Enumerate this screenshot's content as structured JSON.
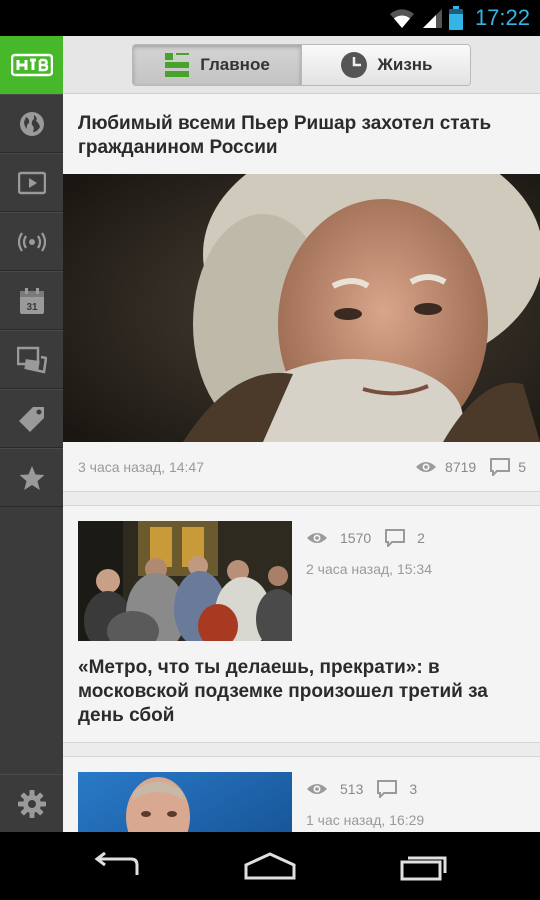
{
  "status_bar": {
    "time": "17:22",
    "icons": [
      "wifi-icon",
      "signal-icon",
      "battery-icon"
    ]
  },
  "sidebar": {
    "logo": "НТВ",
    "items": [
      "globe-icon",
      "video-icon",
      "broadcast-icon",
      "calendar-icon",
      "gallery-icon",
      "tag-icon",
      "star-icon"
    ],
    "calendar_day": "31",
    "settings": "gear-icon"
  },
  "tabs": [
    {
      "label": "Главное",
      "icon": "grid-icon",
      "active": true
    },
    {
      "label": "Жизнь",
      "icon": "clock-icon",
      "active": false
    }
  ],
  "feature": {
    "title": "Любимый всеми Пьер Ришар захотел стать гражданином России",
    "time": "3 часа назад, 14:47",
    "views": "8719",
    "comments": "5"
  },
  "cards": [
    {
      "views": "1570",
      "comments": "2",
      "time": "2 часа назад, 15:34",
      "title": "«Метро, что ты делаешь, прекрати»: в московской подземке произошел третий за день сбой"
    },
    {
      "views": "513",
      "comments": "3",
      "time": "1 час назад, 16:29",
      "title": ""
    }
  ],
  "colors": {
    "brand_green": "#46b829",
    "clock_blue": "#33b5e5",
    "sidebar": "#3b3b3b"
  },
  "navbar": [
    "back-icon",
    "home-icon",
    "recents-icon"
  ]
}
